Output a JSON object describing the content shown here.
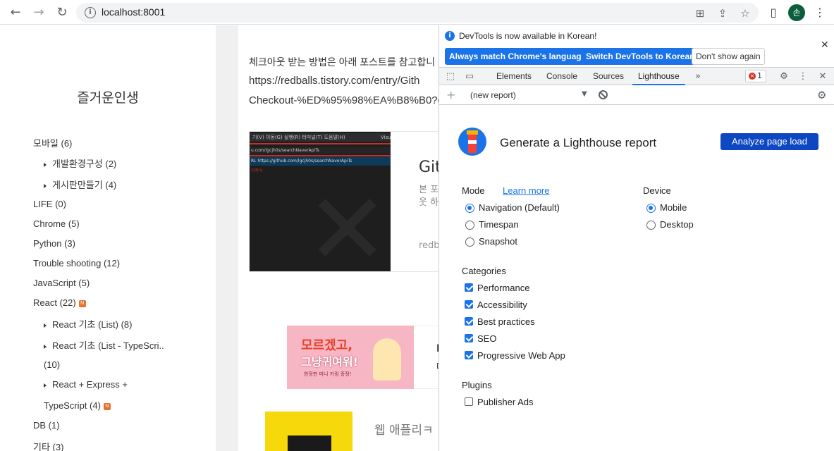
{
  "browser": {
    "url": "localhost:8001",
    "avatar_letter": "손"
  },
  "sidebar": {
    "blog_title": "즐거운인생",
    "categories": [
      {
        "label": "모바일 (6)"
      },
      {
        "label": "개발환경구성 (2)"
      },
      {
        "label": "게시판만들기 (4)"
      },
      {
        "label": "LIFE (0)"
      },
      {
        "label": "Chrome (5)"
      },
      {
        "label": "Python (3)"
      },
      {
        "label": "Trouble shooting (12)"
      },
      {
        "label": "JavaScript (5)"
      },
      {
        "label": "React (22)"
      },
      {
        "label": "React 기초 (List) (8)"
      },
      {
        "label": "React 기초 (List - TypeScri.."
      },
      {
        "label": "(10)"
      },
      {
        "label": "React + Express +"
      },
      {
        "label": "TypeScript (4)"
      },
      {
        "label": "DB (1)"
      },
      {
        "label": "기타 (3)"
      }
    ],
    "new_badge": "N"
  },
  "content": {
    "line1": "체크아웃 받는 방법은 아래 포스트를 참고합니",
    "line2": "https://redballs.tistory.com/entry/Gith",
    "line3": "Checkout-%ED%95%98%EA%B8%B0?c",
    "card": {
      "title": "Git",
      "desc1": "본 포",
      "desc2": "웃 하",
      "footer": "redb",
      "thumb_menu": "기(V)  이동(G)  실행(R)  터미널(T)  도움말(H)",
      "thumb_url": "u.com/lgcjh0s/searchNaverApiTs",
      "thumb_url2": "RL  https://github.com/lgcjh0s/searchNaverApiTs",
      "thumb_right": "Visu",
      "thumb_red": "지작식"
    },
    "ad": {
      "text1": "모르겠고,",
      "text2": "그냥귀여워!",
      "text3": "한정판 미니 키링 증정!",
      "side": "I",
      "side2": "D"
    },
    "bottom_text": "웹 애플리ㅋ"
  },
  "devtools": {
    "info_message": "DevTools is now available in Korean!",
    "btn_match": "Always match Chrome's language",
    "btn_switch": "Switch DevTools to Korean",
    "btn_dont_show": "Don't show again",
    "tabs": [
      "Elements",
      "Console",
      "Sources",
      "Lighthouse"
    ],
    "error_count": "1",
    "report_select": "(new report)",
    "heading": "Generate a Lighthouse report",
    "analyze_label": "Analyze page load",
    "mode_label": "Mode",
    "learn_more": "Learn more",
    "modes": [
      "Navigation (Default)",
      "Timespan",
      "Snapshot"
    ],
    "device_label": "Device",
    "devices": [
      "Mobile",
      "Desktop"
    ],
    "categories_label": "Categories",
    "categories": [
      "Performance",
      "Accessibility",
      "Best practices",
      "SEO",
      "Progressive Web App"
    ],
    "plugins_label": "Plugins",
    "plugins": [
      "Publisher Ads"
    ],
    "accent_color": "#1a73e8"
  }
}
